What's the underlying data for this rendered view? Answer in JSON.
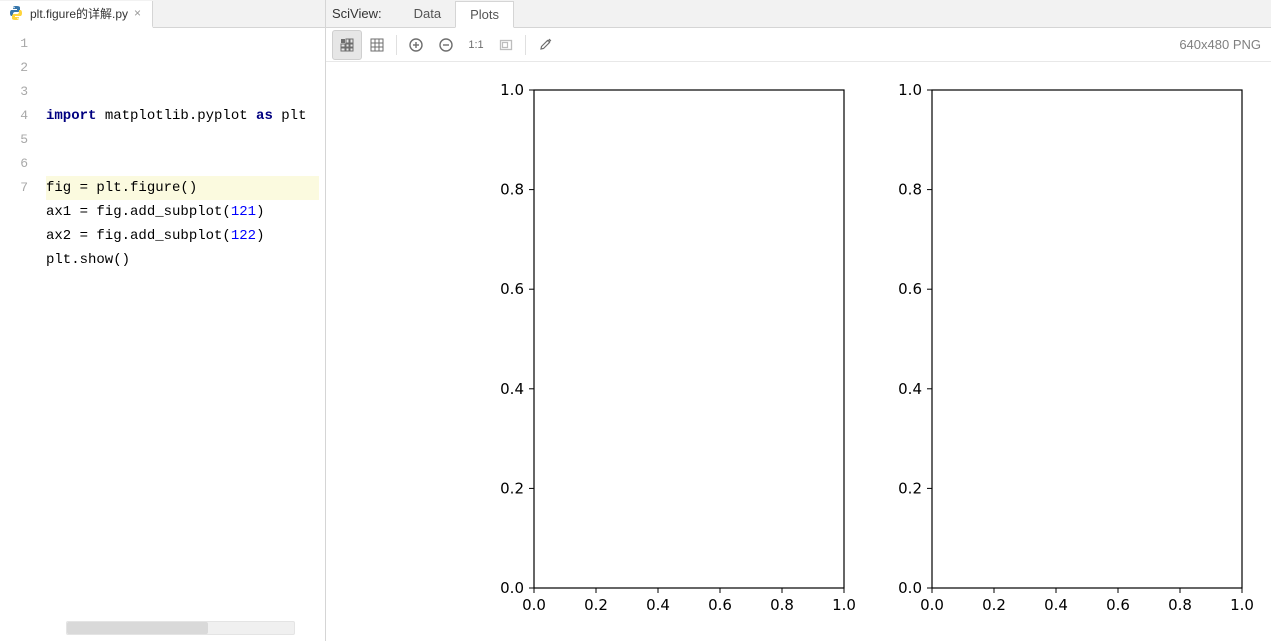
{
  "editor": {
    "tab": {
      "filename": "plt.figure的详解.py"
    },
    "line_numbers": [
      "1",
      "2",
      "3",
      "4",
      "5",
      "6",
      "7"
    ],
    "current_line_index": 6,
    "code_tokens": [
      [
        {
          "t": "import ",
          "c": "kw"
        },
        {
          "t": "matplotlib.pyplot "
        },
        {
          "t": "as ",
          "c": "kw"
        },
        {
          "t": "plt"
        }
      ],
      [],
      [],
      [
        {
          "t": "fig = plt.figure()"
        }
      ],
      [
        {
          "t": "ax1 = fig.add_subplot("
        },
        {
          "t": "121",
          "c": "num"
        },
        {
          "t": ")"
        }
      ],
      [
        {
          "t": "ax2 = fig.add_subplot("
        },
        {
          "t": "122",
          "c": "num"
        },
        {
          "t": ")"
        }
      ],
      [
        {
          "t": "plt.show()"
        }
      ]
    ]
  },
  "sciview": {
    "title": "SciView:",
    "tabs": {
      "data": "Data",
      "plots": "Plots"
    },
    "active_tab": "plots",
    "image_dims": "640x480 PNG"
  },
  "chart_data": [
    {
      "type": "line",
      "series": [],
      "x_ticks": [
        0.0,
        0.2,
        0.4,
        0.6,
        0.8,
        1.0
      ],
      "y_ticks": [
        0.0,
        0.2,
        0.4,
        0.6,
        0.8,
        1.0
      ],
      "xlim": [
        0.0,
        1.0
      ],
      "ylim": [
        0.0,
        1.0
      ],
      "title": "",
      "xlabel": "",
      "ylabel": ""
    },
    {
      "type": "line",
      "series": [],
      "x_ticks": [
        0.0,
        0.2,
        0.4,
        0.6,
        0.8,
        1.0
      ],
      "y_ticks": [
        0.0,
        0.2,
        0.4,
        0.6,
        0.8,
        1.0
      ],
      "xlim": [
        0.0,
        1.0
      ],
      "ylim": [
        0.0,
        1.0
      ],
      "title": "",
      "xlabel": "",
      "ylabel": ""
    }
  ]
}
